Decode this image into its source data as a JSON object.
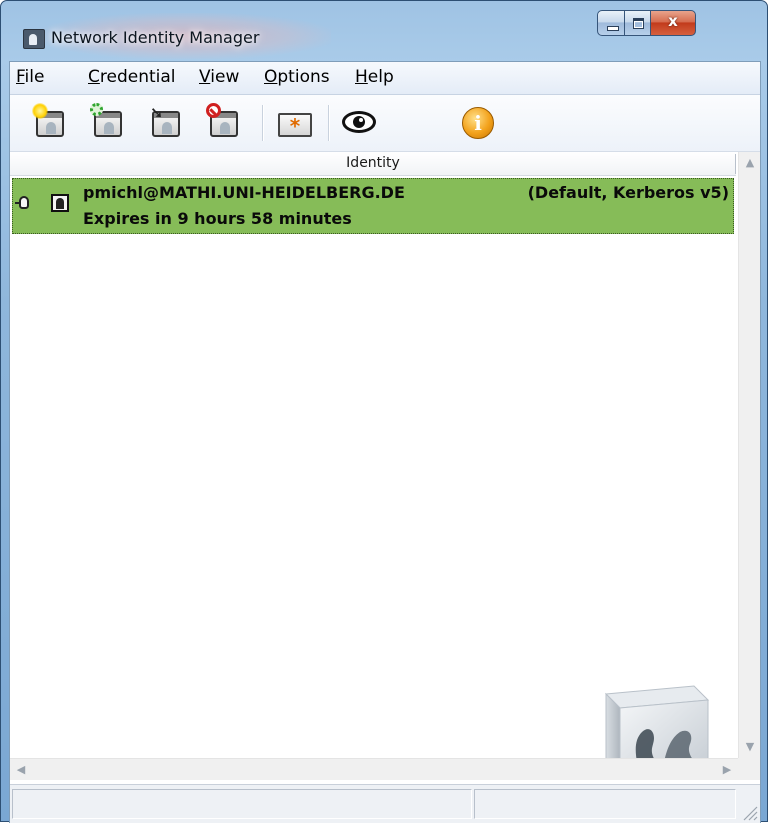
{
  "window": {
    "title": "Network Identity Manager",
    "close_glyph": "x"
  },
  "menu": {
    "items": [
      {
        "first": "F",
        "rest": "ile"
      },
      {
        "first": "C",
        "rest": "redential"
      },
      {
        "first": "V",
        "rest": "iew"
      },
      {
        "first": "O",
        "rest": "ptions"
      },
      {
        "first": "H",
        "rest": "elp"
      }
    ]
  },
  "toolbar": {
    "buttons": [
      {
        "icon": "new-credentials-icon"
      },
      {
        "icon": "renew-credentials-icon"
      },
      {
        "icon": "import-credentials-icon"
      },
      {
        "icon": "destroy-credentials-icon"
      },
      {
        "icon": "change-password-icon",
        "glyph": "*"
      },
      {
        "icon": "view-credentials-icon"
      },
      {
        "icon": "help-info-icon",
        "glyph": "i"
      }
    ]
  },
  "list": {
    "column_header": "Identity",
    "identities": [
      {
        "principal": "pmichl@MATHI.UNI-HEIDELBERG.DE",
        "meta": "(Default, Kerberos v5)",
        "expiry": "Expires in 9 hours 58 minutes"
      }
    ]
  },
  "scrollbars": {
    "up": "▲",
    "down": "▼",
    "left": "◀",
    "right": "▶"
  },
  "statusbar": {
    "left_text": "",
    "right_text": ""
  },
  "colors": {
    "selected_row": "#86bc58",
    "title_bar": "#a9cbe9",
    "close_button": "#c23b1c"
  }
}
